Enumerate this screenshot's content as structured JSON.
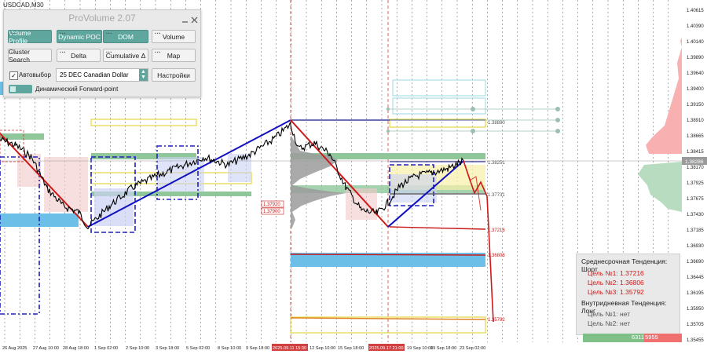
{
  "symbol": "USDCAD,M30",
  "panel": {
    "title": "ProVolume 2.07",
    "buttons": [
      "Volume Profile",
      "Dynamic POC",
      "DOM",
      "Volume",
      "Cluster Search",
      "Delta",
      "Cumulative Δ",
      "Map"
    ],
    "auto_label": "Автовыбор",
    "instrument": "25 DEC Canadian Dollar",
    "settings_label": "Настройки",
    "forward_label": "Динамический Forward-point"
  },
  "price_axis": [
    "1.40615",
    "1.40390",
    "1.40140",
    "1.39890",
    "1.39640",
    "1.39400",
    "1.39150",
    "1.38910",
    "1.38665",
    "1.38415",
    "1.38170",
    "1.37925",
    "1.37675",
    "1.37430",
    "1.37185",
    "1.36930",
    "1.36690",
    "1.36445",
    "1.36195",
    "1.35950",
    "1.35705",
    "1.35455"
  ],
  "current_price": "1.38286",
  "time_axis": [
    "26 Aug 2025",
    "27 Aug 10:00",
    "28 Aug 18:00",
    "1 Sep 02:00",
    "2 Sep 10:00",
    "3 Sep 18:00",
    "5 Sep 02:00",
    "8 Sep 10:00",
    "9 Sep 18:00",
    "2025.09.11 15:30",
    "12 Sep 10:00",
    "15 Sep 18:00",
    "2025.09.17 21:00",
    "19 Sep 10:00",
    "19 Sep 18:00",
    "23 Sep 02:00"
  ],
  "level_labels": [
    "1.38880",
    "1.38251",
    "1.37731",
    "1.37216",
    "1.36806",
    "1.35792"
  ],
  "poc_labels": [
    "1.37920",
    "1.37900"
  ],
  "trend": {
    "mid_title": "Среднесрочная Тенденция: Шорт",
    "mid_targets": [
      "Цель №1: 1.37216",
      "Цель №2: 1.36806",
      "Цель №3: 1.35792"
    ],
    "intra_title": "Внутридневная Тенденция: Лонг",
    "intra_targets": [
      "Цель №1: нет",
      "Цель №2: нет"
    ]
  },
  "volume_bar": {
    "left": "6311",
    "right": "5955"
  },
  "colors": {
    "accent": "#5fa79e",
    "bull_line": "#1010c0",
    "bear_line": "#d01818",
    "profile_green": "#7fbf88",
    "profile_blue": "#6cc0e8"
  }
}
